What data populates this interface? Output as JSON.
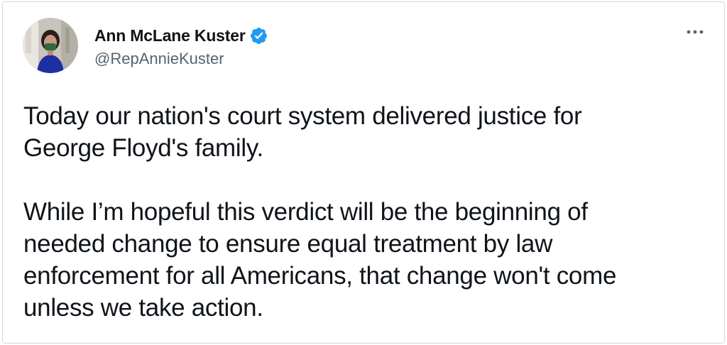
{
  "tweet": {
    "author": {
      "display_name": "Ann McLane Kuster",
      "handle": "@RepAnnieKuster",
      "verified": true,
      "avatar_icon": "profile-photo"
    },
    "more_icon": "ellipsis-icon",
    "paragraphs": [
      "Today our nation's court system delivered justice for\nGeorge Floyd's family.",
      "While I’m hopeful this verdict will be the beginning of\nneeded change to ensure equal treatment by law\nenforcement for all Americans, that change won't come\nunless we take action."
    ]
  },
  "colors": {
    "text_primary": "#0f1419",
    "text_secondary": "#536471",
    "verified_blue": "#1d9bf0",
    "border": "#cfd9de"
  }
}
